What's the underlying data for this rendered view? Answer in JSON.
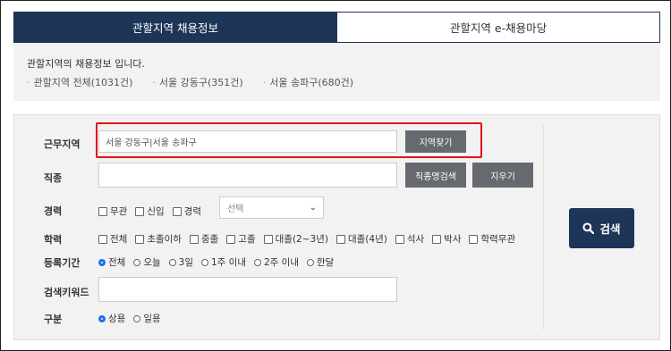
{
  "tabs": [
    {
      "label": "관할지역 채용정보",
      "active": true
    },
    {
      "label": "관할지역 e-채용마당",
      "active": false
    }
  ],
  "info": {
    "title": "관할지역의 채용정보 입니다.",
    "links": [
      "관할지역 전체(1031건)",
      "서울 강동구(351건)",
      "서울 송파구(680건)"
    ]
  },
  "form": {
    "region": {
      "label": "근무지역",
      "value": "서울 강동구|서울 송파구",
      "button": "지역찾기"
    },
    "job": {
      "label": "직종",
      "value": "",
      "search_button": "직종명검색",
      "clear_button": "지우기"
    },
    "career": {
      "label": "경력",
      "options": [
        "무관",
        "신입",
        "경력"
      ],
      "select_value": "선택"
    },
    "education": {
      "label": "학력",
      "options": [
        "전체",
        "초졸이하",
        "중졸",
        "고졸",
        "대졸(2~3년)",
        "대졸(4년)",
        "석사",
        "박사",
        "학력무관"
      ]
    },
    "period": {
      "label": "등록기간",
      "options": [
        "전체",
        "오늘",
        "3일",
        "1주 이내",
        "2주 이내",
        "한달"
      ],
      "selected": "전체"
    },
    "keyword": {
      "label": "검색키워드",
      "value": ""
    },
    "type": {
      "label": "구분",
      "options": [
        "상용",
        "일용"
      ],
      "selected": "상용"
    }
  },
  "search_button": {
    "label": "검색",
    "icon": "search-icon"
  },
  "colors": {
    "navy": "#1d3557",
    "gray_button": "#666a70",
    "highlight": "#e0141a",
    "radio": "#1a73e8"
  }
}
